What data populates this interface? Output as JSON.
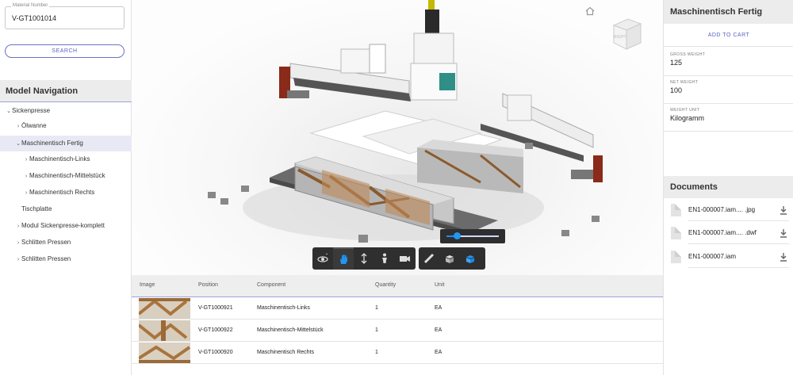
{
  "search": {
    "field_label": "Material Number",
    "value": "V-GT1001014",
    "button": "SEARCH"
  },
  "nav": {
    "title": "Model Navigation",
    "items": [
      {
        "label": "Sickenpresse",
        "chevron": "down"
      },
      {
        "label": "Ölwanne",
        "chevron": "right"
      },
      {
        "label": "Maschinentisch Fertig",
        "chevron": "down"
      },
      {
        "label": "Maschinentisch-Links",
        "chevron": "right"
      },
      {
        "label": "Maschinentisch-Mittelstück",
        "chevron": "right"
      },
      {
        "label": "Maschinentisch Rechts",
        "chevron": "right"
      },
      {
        "label": "Tischplatte",
        "chevron": "none"
      },
      {
        "label": "Modul Sickenpresse-komplett",
        "chevron": "right"
      },
      {
        "label": "Schlitten Pressen",
        "chevron": "right"
      },
      {
        "label": "Schlitten Pressen",
        "chevron": "right"
      }
    ]
  },
  "viewer": {
    "viewcube_label": "RIGHT",
    "slider_value": 0.2,
    "tools": [
      "orbit-icon",
      "pan-icon",
      "dolly-icon",
      "first-person-icon",
      "camera-icon",
      "measure-icon",
      "explode-icon",
      "model-browser-icon"
    ]
  },
  "table": {
    "headers": {
      "image": "Image",
      "position": "Position",
      "component": "Component",
      "quantity": "Quantity",
      "unit": "Unit"
    },
    "rows": [
      {
        "position": "V-GT1000921",
        "component": "Maschinentisch-Links",
        "quantity": "1",
        "unit": "EA"
      },
      {
        "position": "V-GT1000922",
        "component": "Maschinentisch-Mittelstück",
        "quantity": "1",
        "unit": "EA"
      },
      {
        "position": "V-GT1000920",
        "component": "Maschinentisch Rechts",
        "quantity": "1",
        "unit": "EA"
      }
    ]
  },
  "detail": {
    "title": "Maschinentisch Fertig",
    "add_to_cart": "ADD TO CART",
    "props": [
      {
        "key": "GROSS WEIGHT",
        "value": "125"
      },
      {
        "key": "NET WEIGHT",
        "value": "100"
      },
      {
        "key": "WEIGHT UNIT",
        "value": "Kilogramm"
      }
    ]
  },
  "documents": {
    "title": "Documents",
    "files": [
      {
        "name": "EN1-000007.iam.... .jpg"
      },
      {
        "name": "EN1-000007.iam.... .dwf"
      },
      {
        "name": "EN1-000007.iam"
      }
    ]
  },
  "colors": {
    "accent": "#5a63c0",
    "active_tool": "#2196f3",
    "panel_header": "#ececec"
  }
}
